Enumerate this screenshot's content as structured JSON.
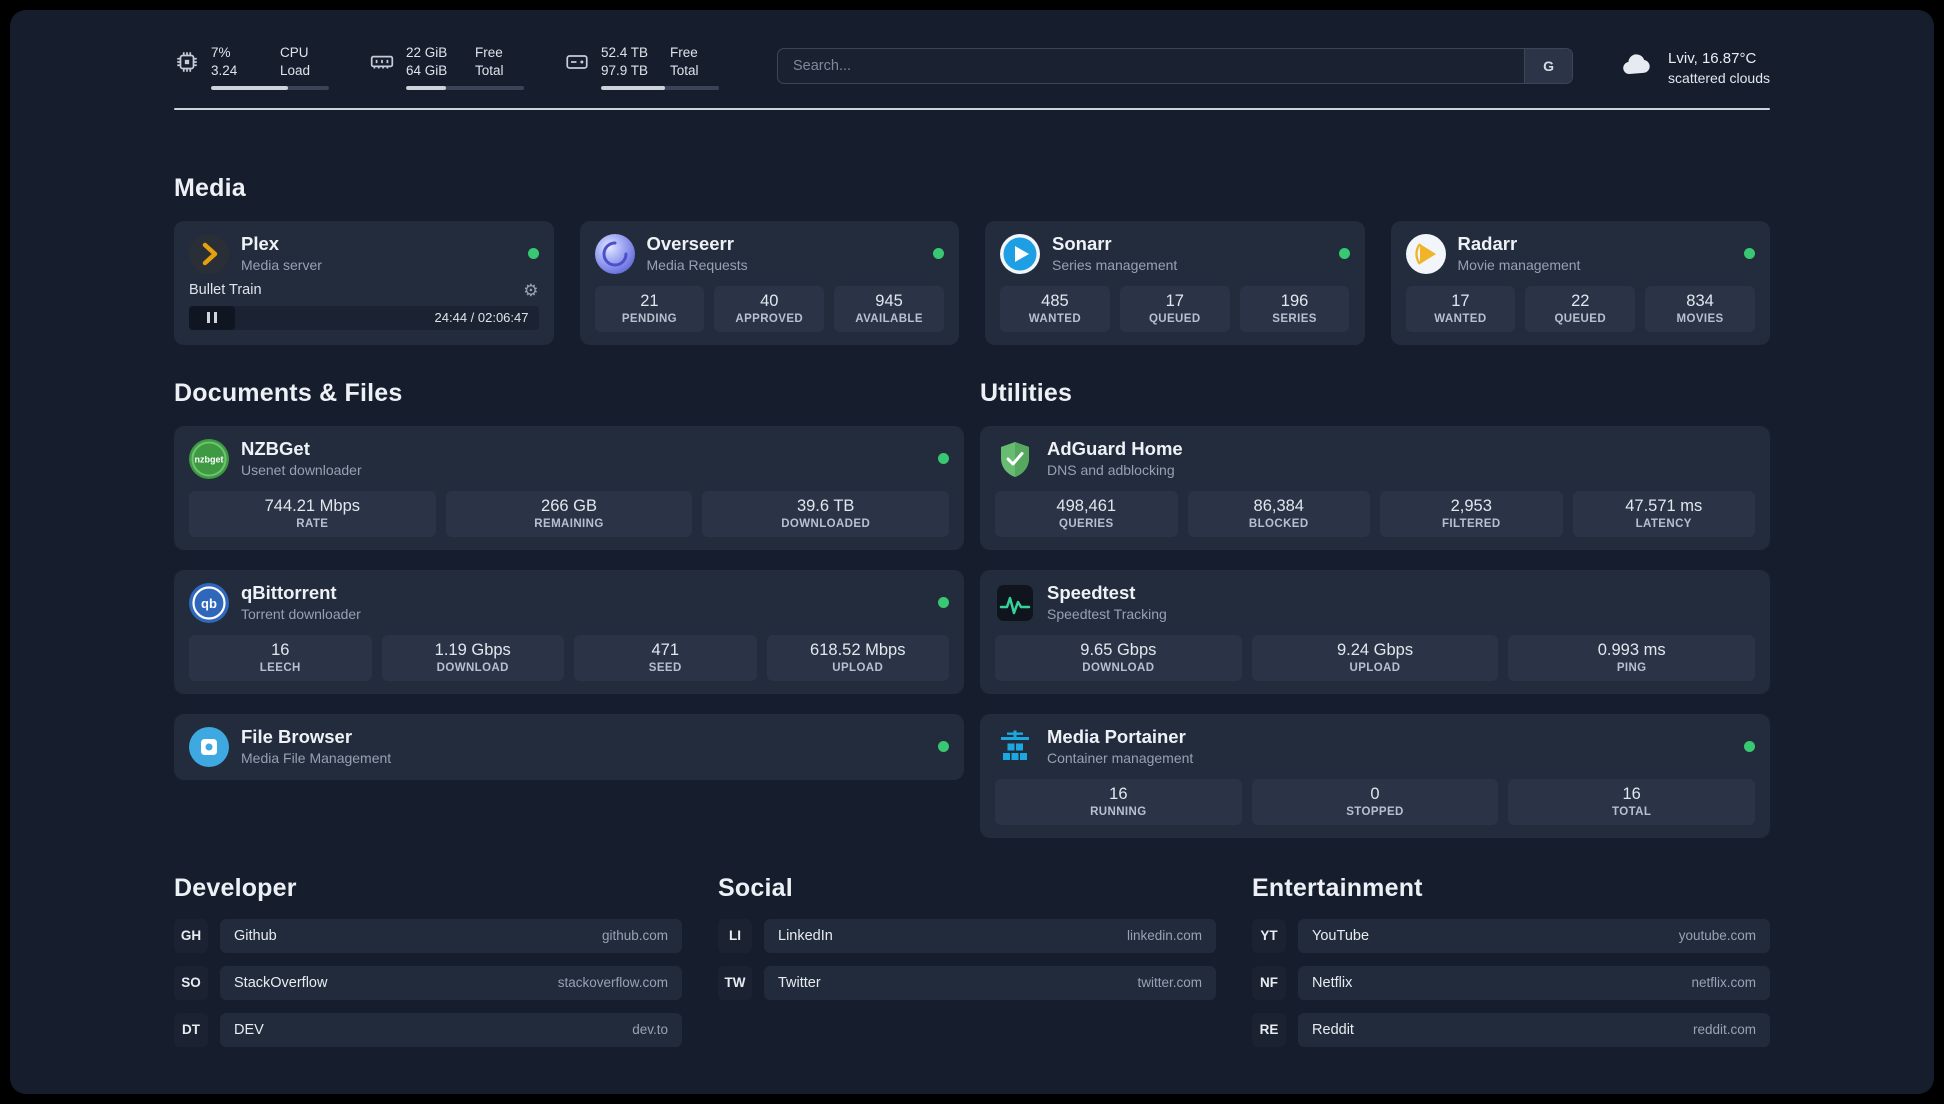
{
  "colors": {
    "background": "#161d2d",
    "card": "#232c3d",
    "stat_box": "#2a3446",
    "status_online": "#37c871",
    "plex_amber": "#e5a00d",
    "sonarr_blue": "#1e9fe3",
    "radarr_amber": "#f0b429",
    "speedtest_green": "#36d399",
    "portainer_blue": "#1ba7e0"
  },
  "topbar": {
    "cpu": {
      "value": "7%",
      "sub": "3.24",
      "label_top": "CPU",
      "label_bottom": "Load",
      "bar_style": "width:65%"
    },
    "ram": {
      "value": "22 GiB",
      "sub": "64 GiB",
      "label_top": "Free",
      "label_bottom": "Total",
      "bar_style": "width:34%"
    },
    "disk": {
      "value": "52.4 TB",
      "sub": "97.9 TB",
      "label_top": "Free",
      "label_bottom": "Total",
      "bar_style": "width:54%"
    },
    "search": {
      "placeholder": "Search...",
      "engine_label": "G"
    },
    "weather": {
      "location": "Lviv, 16.87°C",
      "condition": "scattered clouds"
    }
  },
  "sections": {
    "media": "Media",
    "documents": "Documents & Files",
    "utilities": "Utilities",
    "developer": "Developer",
    "social": "Social",
    "entertainment": "Entertainment"
  },
  "services": {
    "plex": {
      "name": "Plex",
      "desc": "Media server",
      "now_playing": "Bullet Train",
      "time": "24:44 / 02:06:47"
    },
    "overseerr": {
      "name": "Overseerr",
      "desc": "Media Requests",
      "stats": [
        {
          "value": "21",
          "label": "PENDING"
        },
        {
          "value": "40",
          "label": "APPROVED"
        },
        {
          "value": "945",
          "label": "AVAILABLE"
        }
      ]
    },
    "sonarr": {
      "name": "Sonarr",
      "desc": "Series management",
      "stats": [
        {
          "value": "485",
          "label": "WANTED"
        },
        {
          "value": "17",
          "label": "QUEUED"
        },
        {
          "value": "196",
          "label": "SERIES"
        }
      ]
    },
    "radarr": {
      "name": "Radarr",
      "desc": "Movie management",
      "stats": [
        {
          "value": "17",
          "label": "WANTED"
        },
        {
          "value": "22",
          "label": "QUEUED"
        },
        {
          "value": "834",
          "label": "MOVIES"
        }
      ]
    },
    "nzbget": {
      "name": "NZBGet",
      "desc": "Usenet downloader",
      "stats": [
        {
          "value": "744.21 Mbps",
          "label": "RATE"
        },
        {
          "value": "266 GB",
          "label": "REMAINING"
        },
        {
          "value": "39.6 TB",
          "label": "DOWNLOADED"
        }
      ]
    },
    "qbittorrent": {
      "name": "qBittorrent",
      "desc": "Torrent downloader",
      "stats": [
        {
          "value": "16",
          "label": "LEECH"
        },
        {
          "value": "1.19 Gbps",
          "label": "DOWNLOAD"
        },
        {
          "value": "471",
          "label": "SEED"
        },
        {
          "value": "618.52 Mbps",
          "label": "UPLOAD"
        }
      ]
    },
    "filebrowser": {
      "name": "File Browser",
      "desc": "Media File Management"
    },
    "adguard": {
      "name": "AdGuard Home",
      "desc": "DNS and adblocking",
      "stats": [
        {
          "value": "498,461",
          "label": "QUERIES"
        },
        {
          "value": "86,384",
          "label": "BLOCKED"
        },
        {
          "value": "2,953",
          "label": "FILTERED"
        },
        {
          "value": "47.571 ms",
          "label": "LATENCY"
        }
      ]
    },
    "speedtest": {
      "name": "Speedtest",
      "desc": "Speedtest Tracking",
      "stats": [
        {
          "value": "9.65 Gbps",
          "label": "DOWNLOAD"
        },
        {
          "value": "9.24 Gbps",
          "label": "UPLOAD"
        },
        {
          "value": "0.993 ms",
          "label": "PING"
        }
      ]
    },
    "portainer": {
      "name": "Media Portainer",
      "desc": "Container management",
      "stats": [
        {
          "value": "16",
          "label": "RUNNING"
        },
        {
          "value": "0",
          "label": "STOPPED"
        },
        {
          "value": "16",
          "label": "TOTAL"
        }
      ]
    }
  },
  "bookmarks": {
    "developer": [
      {
        "abbr": "GH",
        "name": "Github",
        "url": "github.com"
      },
      {
        "abbr": "SO",
        "name": "StackOverflow",
        "url": "stackoverflow.com"
      },
      {
        "abbr": "DT",
        "name": "DEV",
        "url": "dev.to"
      }
    ],
    "social": [
      {
        "abbr": "LI",
        "name": "LinkedIn",
        "url": "linkedin.com"
      },
      {
        "abbr": "TW",
        "name": "Twitter",
        "url": "twitter.com"
      }
    ],
    "entertainment": [
      {
        "abbr": "YT",
        "name": "YouTube",
        "url": "youtube.com"
      },
      {
        "abbr": "NF",
        "name": "Netflix",
        "url": "netflix.com"
      },
      {
        "abbr": "RE",
        "name": "Reddit",
        "url": "reddit.com"
      }
    ]
  }
}
